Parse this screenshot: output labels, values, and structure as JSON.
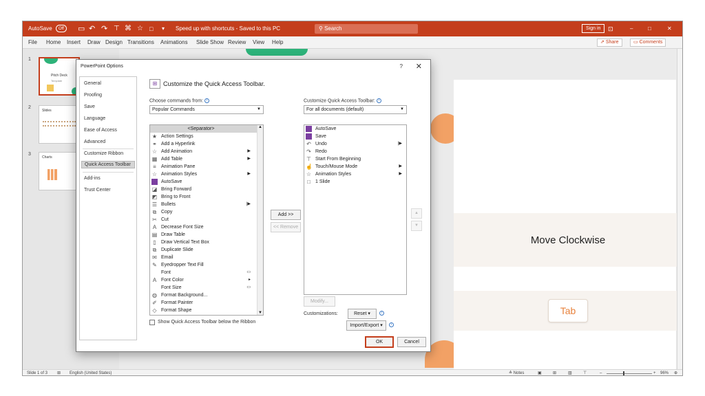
{
  "titlebar": {
    "autosave_label": "AutoSave",
    "autosave_state": "Off",
    "doc_status": "Speed up with shortcuts - Saved to this PC",
    "search_placeholder": "Search",
    "signin_label": "Sign in",
    "minimize": "–",
    "restore": "□",
    "close": "✕"
  },
  "menu": {
    "items": [
      "File",
      "Home",
      "Insert",
      "Draw",
      "Design",
      "Transitions",
      "Animations",
      "Slide Show",
      "Review",
      "View",
      "Help"
    ],
    "share_label": "Share",
    "comments_label": "Comments"
  },
  "thumbnails": [
    {
      "number": "1",
      "title": "Pitch Deck",
      "subtitle": "Template"
    },
    {
      "number": "2",
      "title": "Slides"
    },
    {
      "number": "3",
      "title": "Charts"
    }
  ],
  "slide": {
    "heading": "Move Clockwise",
    "tab_key": "Tab"
  },
  "status": {
    "slide_count": "Slide 1 of 3",
    "language": "English (United States)",
    "notes": "Notes",
    "zoom": "96%"
  },
  "dialog": {
    "title": "PowerPoint Options",
    "help": "?",
    "close": "✕",
    "nav": [
      "General",
      "Proofing",
      "Save",
      "Language",
      "Ease of Access",
      "Advanced",
      "Customize Ribbon",
      "Quick Access Toolbar",
      "Add-ins",
      "Trust Center"
    ],
    "selected_nav": "Quick Access Toolbar",
    "section_heading": "Customize the Quick Access Toolbar.",
    "choose_label": "Choose commands from:",
    "choose_value": "Popular Commands",
    "customize_label": "Customize Quick Access Toolbar:",
    "customize_value": "For all documents (default)",
    "commands": [
      {
        "label": "<Separator>",
        "icon": "separator"
      },
      {
        "label": "Action Settings",
        "icon": "action-icon"
      },
      {
        "label": "Add a Hyperlink",
        "icon": "link-icon"
      },
      {
        "label": "Add Animation",
        "icon": "star-icon",
        "submenu": true
      },
      {
        "label": "Add Table",
        "icon": "table-icon",
        "submenu": true
      },
      {
        "label": "Animation Pane",
        "icon": "pane-icon"
      },
      {
        "label": "Animation Styles",
        "icon": "star-icon",
        "submenu": true
      },
      {
        "label": "AutoSave",
        "icon": "save-icon"
      },
      {
        "label": "Bring Forward",
        "icon": "forward-icon"
      },
      {
        "label": "Bring to Front",
        "icon": "front-icon"
      },
      {
        "label": "Bullets",
        "icon": "bullets-icon"
      },
      {
        "label": "Copy",
        "icon": "copy-icon"
      },
      {
        "label": "Cut",
        "icon": "cut-icon"
      },
      {
        "label": "Decrease Font Size",
        "icon": "font-decrease-icon"
      },
      {
        "label": "Draw Table",
        "icon": "draw-table-icon"
      },
      {
        "label": "Draw Vertical Text Box",
        "icon": "textbox-icon"
      },
      {
        "label": "Duplicate Slide",
        "icon": "duplicate-icon"
      },
      {
        "label": "Email",
        "icon": "email-icon"
      },
      {
        "label": "Eyedropper Text Fill",
        "icon": "eyedropper-icon"
      },
      {
        "label": "Font",
        "icon": "none"
      },
      {
        "label": "Font Color",
        "icon": "font-color-icon"
      },
      {
        "label": "Font Size",
        "icon": "none"
      },
      {
        "label": "Format Background...",
        "icon": "background-icon"
      },
      {
        "label": "Format Painter",
        "icon": "painter-icon"
      },
      {
        "label": "Format Shape",
        "icon": "shape-icon"
      }
    ],
    "toolbar_items": [
      {
        "label": "AutoSave",
        "icon": "save-icon"
      },
      {
        "label": "Save",
        "icon": "save-icon"
      },
      {
        "label": "Undo",
        "icon": "undo-icon"
      },
      {
        "label": "Redo",
        "icon": "redo-icon"
      },
      {
        "label": "Start From Beginning",
        "icon": "present-icon"
      },
      {
        "label": "Touch/Mouse Mode",
        "icon": "touch-icon"
      },
      {
        "label": "Animation Styles",
        "icon": "star-icon"
      },
      {
        "label": "1 Slide",
        "icon": "slide-icon"
      }
    ],
    "add_button": "Add >>",
    "remove_button": "<< Remove",
    "modify_button": "Modify...",
    "customizations_label": "Customizations:",
    "reset_button": "Reset ▾",
    "import_export_button": "Import/Export ▾",
    "show_below_label": "Show Quick Access Toolbar below the Ribbon",
    "ok_button": "OK",
    "cancel_button": "Cancel"
  },
  "colors": {
    "accent": "#c43e1c",
    "orange": "#f2a165",
    "green": "#2db37a"
  }
}
